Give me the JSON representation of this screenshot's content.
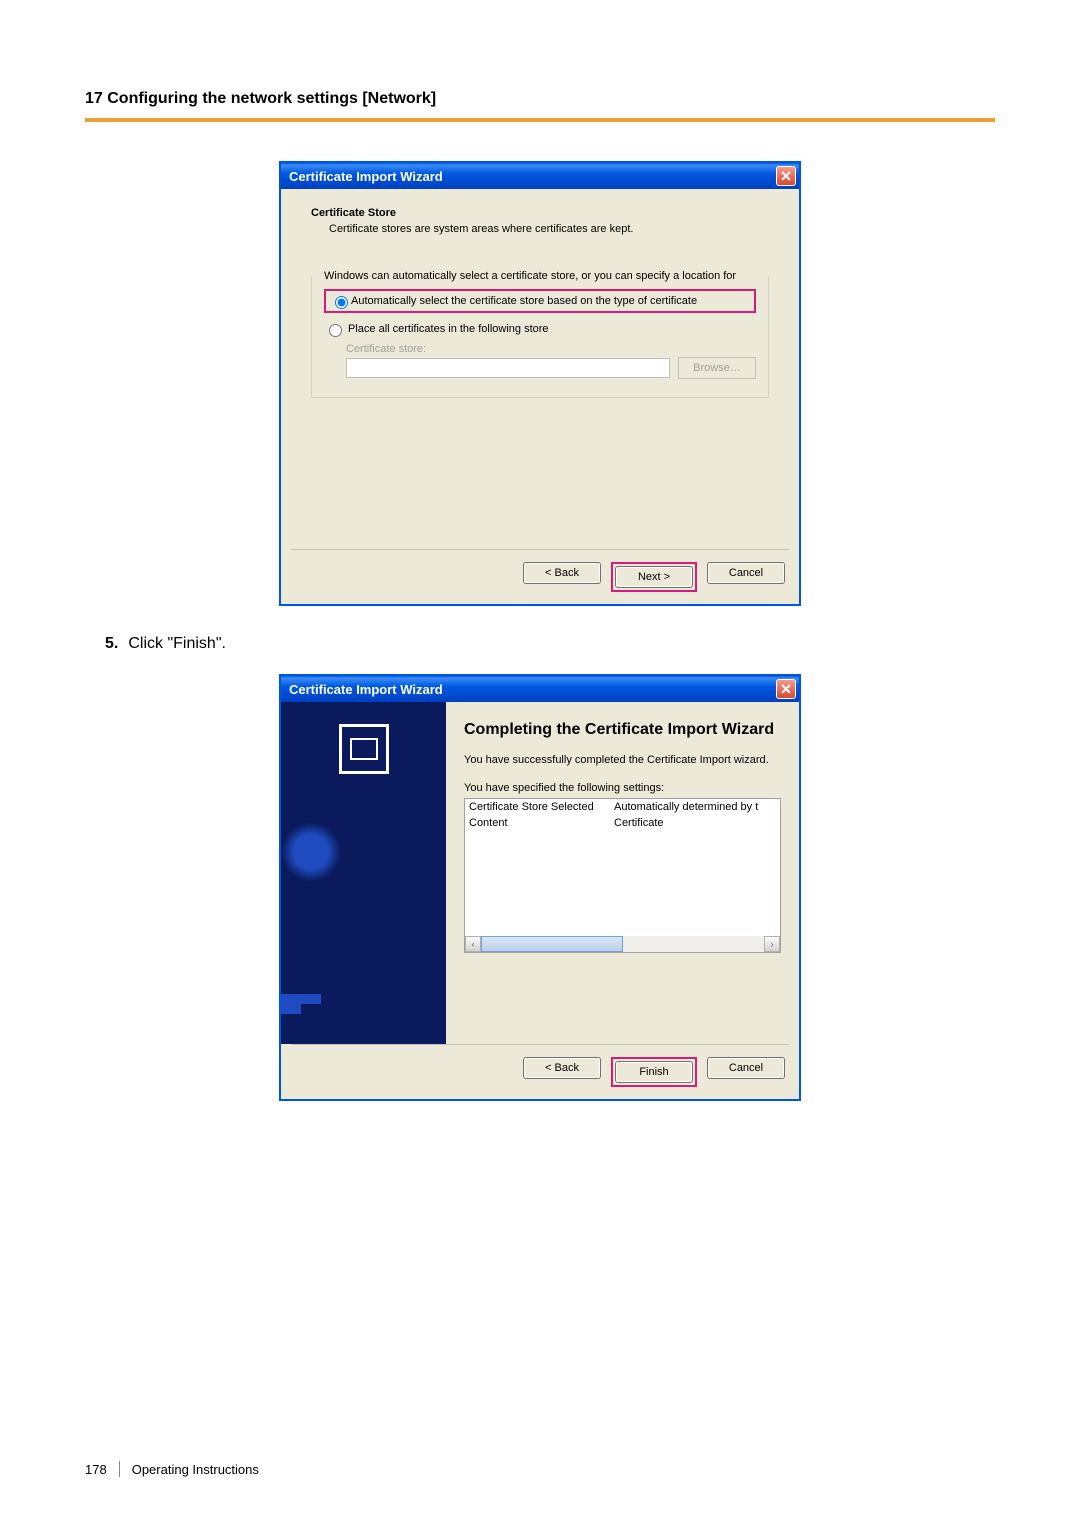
{
  "header": "17 Configuring the network settings [Network]",
  "dialog1": {
    "title": "Certificate Import Wizard",
    "section_title": "Certificate Store",
    "section_desc": "Certificate stores are system areas where certificates are kept.",
    "group_text": "Windows can automatically select a certificate store, or you can specify a location for",
    "radio_auto": "Automatically select the certificate store based on the type of certificate",
    "radio_place": "Place all certificates in the following store",
    "store_label": "Certificate store:",
    "browse": "Browse…",
    "back": "< Back",
    "next": "Next >",
    "cancel": "Cancel"
  },
  "step": {
    "num": "5.",
    "text": "Click \"Finish\"."
  },
  "dialog2": {
    "title": "Certificate Import Wizard",
    "heading": "Completing the Certificate Import Wizard",
    "msg1": "You have successfully completed the Certificate Import wizard.",
    "msg2": "You have specified the following settings:",
    "row1_c1": "Certificate Store Selected",
    "row1_c2": "Automatically determined by t",
    "row2_c1": "Content",
    "row2_c2": "Certificate",
    "back": "< Back",
    "finish": "Finish",
    "cancel": "Cancel"
  },
  "footer": {
    "page": "178",
    "title": "Operating Instructions"
  }
}
